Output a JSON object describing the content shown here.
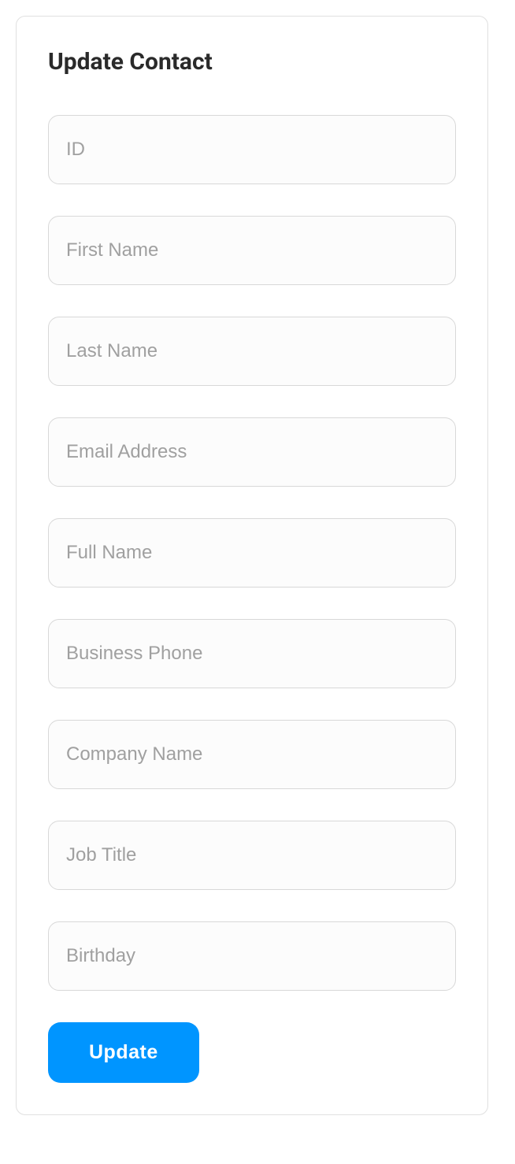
{
  "form": {
    "title": "Update Contact",
    "fields": {
      "id": {
        "placeholder": "ID",
        "value": ""
      },
      "first_name": {
        "placeholder": "First Name",
        "value": ""
      },
      "last_name": {
        "placeholder": "Last Name",
        "value": ""
      },
      "email": {
        "placeholder": "Email Address",
        "value": ""
      },
      "full_name": {
        "placeholder": "Full Name",
        "value": ""
      },
      "business_phone": {
        "placeholder": "Business Phone",
        "value": ""
      },
      "company_name": {
        "placeholder": "Company Name",
        "value": ""
      },
      "job_title": {
        "placeholder": "Job Title",
        "value": ""
      },
      "birthday": {
        "placeholder": "Birthday",
        "value": ""
      }
    },
    "submit_label": "Update"
  }
}
